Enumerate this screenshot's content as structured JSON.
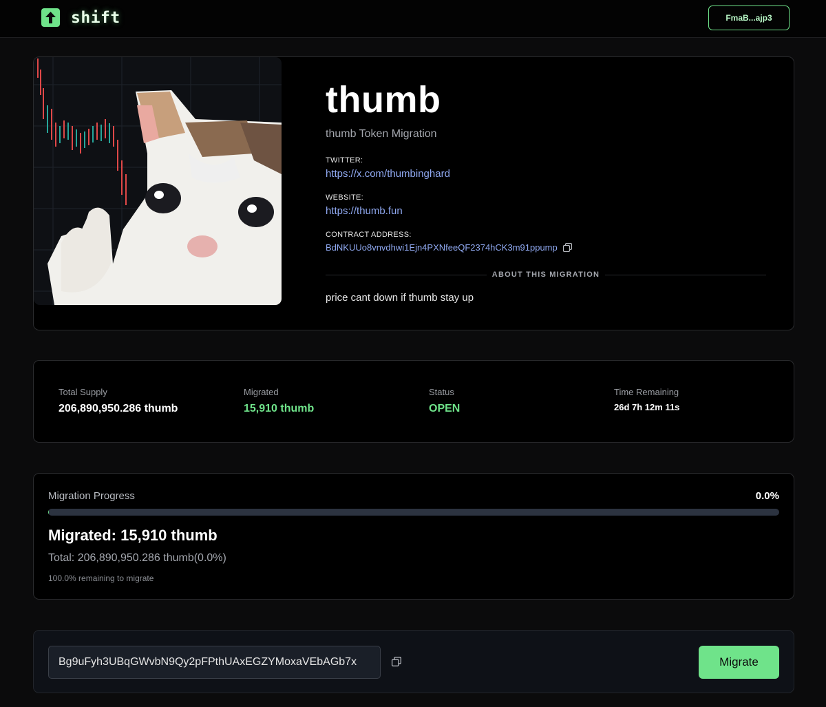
{
  "header": {
    "logo_text": "shift",
    "wallet_label": "FmaB...ajp3"
  },
  "token": {
    "name": "thumb",
    "subtitle": "thumb Token Migration",
    "twitter_label": "TWITTER:",
    "twitter_url": "https://x.com/thumbinghard",
    "website_label": "WEBSITE:",
    "website_url": "https://thumb.fun",
    "contract_label": "CONTRACT ADDRESS:",
    "contract_address": "BdNKUUo8vnvdhwi1Ejn4PXNfeeQF2374hCK3m91ppump",
    "about_heading": "ABOUT THIS MIGRATION",
    "about_text": "price cant down if thumb stay up"
  },
  "stats": {
    "total_supply_label": "Total Supply",
    "total_supply_value": "206,890,950.286 thumb",
    "migrated_label": "Migrated",
    "migrated_value": "15,910 thumb",
    "status_label": "Status",
    "status_value": "OPEN",
    "time_label": "Time Remaining",
    "time_value": "26d 7h 12m 11s"
  },
  "progress": {
    "title": "Migration Progress",
    "percent_text": "0.0%",
    "fraction": 0.0,
    "migrated_text": "Migrated: 15,910 thumb",
    "total_text": "Total: 206,890,950.286 thumb(0.0%)",
    "remaining_text": "100.0% remaining to migrate"
  },
  "migrate": {
    "address_value": "Bg9uFyh3UBqGWvbN9Qy2pFPthUAxEGZYMoxaVEbAGb7x",
    "button_label": "Migrate"
  },
  "colors": {
    "accent": "#6fe38a",
    "link": "#8fa8f0",
    "background": "#0b0b0c"
  }
}
